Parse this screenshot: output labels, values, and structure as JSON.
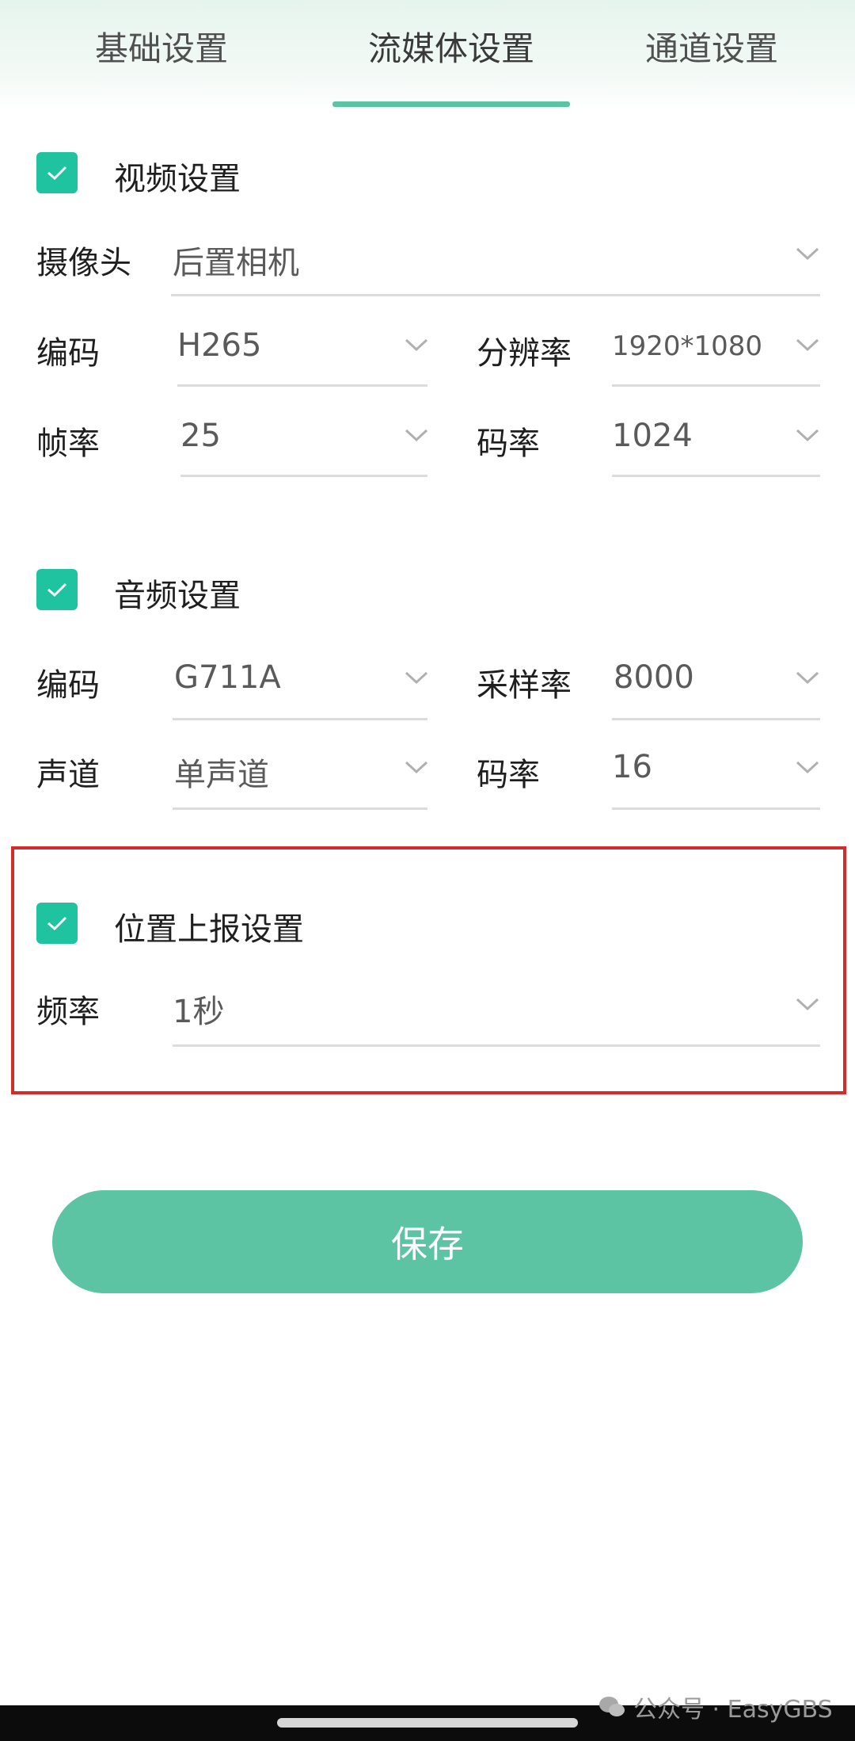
{
  "tabs": [
    {
      "label": "基础设置",
      "active": false
    },
    {
      "label": "流媒体设置",
      "active": true
    },
    {
      "label": "通道设置",
      "active": false
    }
  ],
  "colors": {
    "accent": "#1fc3a0",
    "button": "#5cc3a3",
    "highlight_border": "#d42b2b",
    "tab_underline": "#5cc4a4"
  },
  "video": {
    "checked": true,
    "title": "视频设置",
    "camera": {
      "label": "摄像头",
      "value": "后置相机"
    },
    "codec": {
      "label": "编码",
      "value": "H265"
    },
    "resolution": {
      "label": "分辨率",
      "value": "1920*1080"
    },
    "framerate": {
      "label": "帧率",
      "value": "25"
    },
    "bitrate": {
      "label": "码率",
      "value": "1024"
    }
  },
  "audio": {
    "checked": true,
    "title": "音频设置",
    "codec": {
      "label": "编码",
      "value": "G711A"
    },
    "samplerate": {
      "label": "采样率",
      "value": "8000"
    },
    "channel": {
      "label": "声道",
      "value": "单声道"
    },
    "bitrate": {
      "label": "码率",
      "value": "16"
    }
  },
  "location": {
    "checked": true,
    "title": "位置上报设置",
    "frequency": {
      "label": "频率",
      "value": "1秒"
    }
  },
  "save_label": "保存",
  "watermark": "公众号 · EasyGBS",
  "icons": {
    "checkbox": "check-icon",
    "dropdown": "chevron-down-icon",
    "watermark": "wechat-icon"
  }
}
